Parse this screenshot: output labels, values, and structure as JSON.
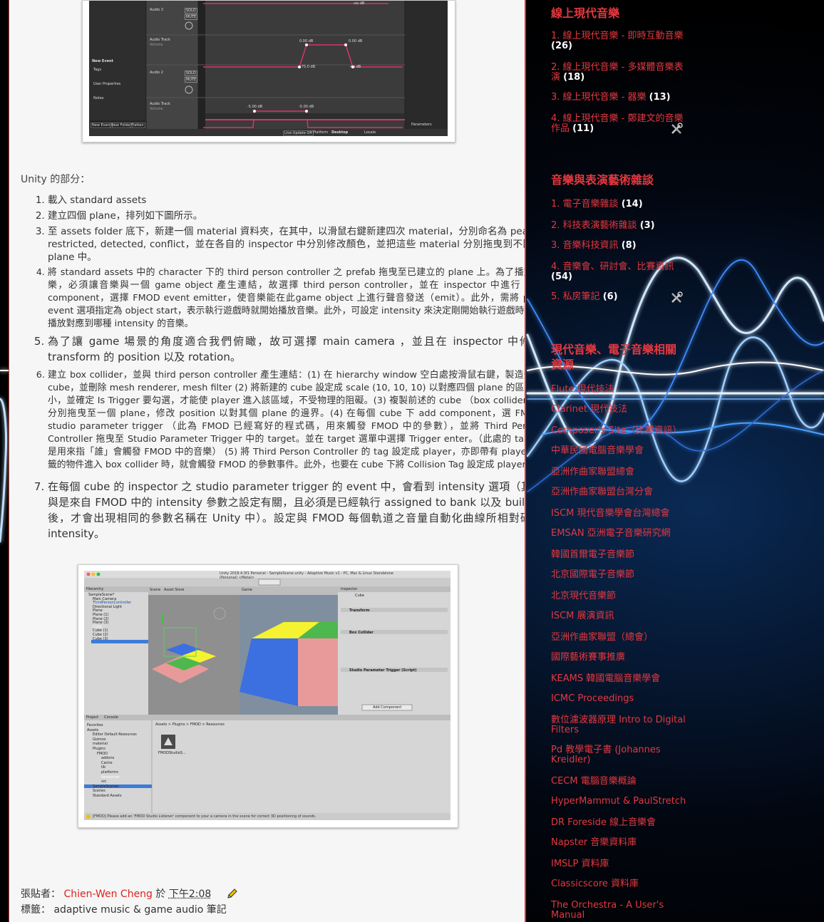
{
  "post": {
    "section_label": "Unity 的部分：",
    "steps": [
      "載入 standard assets",
      "建立四個 plane，排列如下圖所示。",
      "至 assets folder 底下，新建一個 material 資料夾，在其中，以滑鼠右鍵新建四次 material，分別命名為 peace, restricted, detected, conflict，並在各自的 inspector 中分別修改顏色，並把這些 material 分別拖曳到不同的 plane 中。",
      "將 standard assets 中的 character 下的 third person controller 之 prefab 拖曳至已建立的 plane 上。為了播放音樂，必須讓音樂與一個 game object 產生連結，故選擇 third person controller，並在 inspector 中進行 add component，選擇 FMOD event emitter，使音樂能在此game object 上進行聲音發送（emit）。此外，需將 play event 選項指定為 object start，表示執行遊戲時就開始播放音樂。此外，可設定 intensity 來決定剛開始執行遊戲時，需播放對應到哪種 intensity 的音樂。",
      "為了讓 game 場景的角度適合我們俯瞰，故可選擇 main camera ，並且在 inspector 中修改 transform 的 position 以及 rotation。",
      "建立 box collider，並與 third person controller 產生連結：(1) 在 hierarchy window 空白處按滑鼠右鍵，製造一個 cube，並刪除 mesh renderer, mesh filter (2) 將新建的 cube 設定成 scale (10, 10, 10) 以對應四個 plane 的區塊大小，並確定 Is Trigger 要勾選，才能使 player 進入該區域，不受物理的阻礙。(3) 複製前述的 cube （box collider) 並分別拖曳至一個 plane，修改 position 以對其個 plane 的邊界。(4) 在每個 cube 下 add component，選 FMOD studio parameter trigger （此為 FMOD 已經寫好的程式碼，用來觸發 FMOD 中的參數），並將 Third Person Controller 拖曳至 Studio Parameter Trigger 中的 target。並在 target 選單中選擇 Trigger enter。（此處的 target 是用來指「誰」會觸發 FMOD 中的音樂） (5) 將 Third Person Controller 的 tag 設定成 player，亦即帶有 player 標籤的物件進入 box collider 時，就會觸發 FMOD 的參數事件。此外，也要在 cube 下將 Collision Tag 設定成 player。",
      "在每個 cube 的 inspector 之 studio parameter trigger 的 event 中，會看到 intensity 選項（其是與是來自 FMOD 中的 intensity 參數之設定有關，且必須是已經執行 assigned to bank 以及 build之後，才會出現相同的參數名稱在 Unity 中）。設定與 FMOD 每個軌道之音量自動化曲線所相對硬的 intensity。"
    ],
    "footer": {
      "posted_by_label": "張貼者：",
      "author": "Chien-Wen Cheng",
      "at_label": "於",
      "time": "下午2:08",
      "labels_label": "標籤：",
      "labels": "adaptive music & game audio 筆記"
    }
  },
  "fmod_screenshot": {
    "tracks": [
      "Audio 3",
      "Audio Track",
      "Audio 2",
      "Audio Track"
    ],
    "volume_word": "Volume",
    "solo": "SOLO",
    "mute": "MUTE",
    "new_event": "New Event",
    "tags": "Tags",
    "user_properties": "User Properties",
    "notes": "Notes",
    "db_labels": [
      "0.00 dB",
      "0.00 dB",
      "-75.0 dB",
      "-oo dB",
      "-5.00 dB",
      "-5.00 dB",
      "-oo dB"
    ],
    "bottom_buttons": [
      "New Event",
      "New Folder",
      "Flatten"
    ],
    "live_update": "Live Update Off",
    "platform": "Platform",
    "platform_value": "Desktop",
    "locale": "Locale",
    "parameters": "Parameters"
  },
  "unity_screenshot": {
    "title": "Unity 2018.4.3f1 Personal - SampleScene.unity - Adaptive Music v1 - PC, Mac & Linux Standalone (Personal) <Metal>",
    "hierarchy_title": "Hierarchy",
    "hierarchy_items": [
      "SampleScene*",
      "Main Camera",
      "ThirdPersonController",
      "Directional Light",
      "Plane",
      "Plane (1)",
      "Plane (2)",
      "Plane (3)",
      "Cube",
      "Cube (1)",
      "Cube (2)",
      "Cube (3)"
    ],
    "scene_tab": "Scene",
    "asset_store_tab": "Asset Store",
    "game_tab": "Game",
    "inspector_tab": "Inspector",
    "inspector_object": "Cube",
    "components": [
      "Transform",
      "Box Collider",
      "Studio Parameter Trigger (Script)"
    ],
    "add_component": "Add Component",
    "project_tab": "Project",
    "console_tab": "Console",
    "project_tree": [
      "Favorites",
      "Assets",
      "Editor Default Resources",
      "Gizmos",
      "material",
      "Plugins",
      "FMOD",
      "addons",
      "Cache",
      "lib",
      "platforms",
      "Resources",
      "src",
      "SampleScenes",
      "Scenes",
      "Standard Assets"
    ],
    "breadcrumb": "Assets > Plugins > FMOD > Resources",
    "asset_name": "FMODStudioS...",
    "status": "[FMOD] Please add an 'FMOD Studio Listener' component to your a camera in the scene for correct 3D positioning of sounds.",
    "plane_colors": [
      "#f5f230",
      "#4db84d",
      "#3c6fe0",
      "#e89a9a"
    ]
  },
  "sidebar": {
    "widgets": [
      {
        "title": "線上現代音樂",
        "links": [
          {
            "label": "1. 線上現代音樂 - 即時互動音樂",
            "count": "(26)"
          },
          {
            "label": "2. 線上現代音樂 - 多媒體音樂表演",
            "count": "(18)"
          },
          {
            "label": "3. 線上現代音樂 - 器樂",
            "count": "(13)"
          },
          {
            "label": "4. 線上現代音樂 - 鄭建文的音樂作品",
            "count": "(11)"
          }
        ]
      },
      {
        "title": "音樂與表演藝術雜談",
        "links": [
          {
            "label": "1. 電子音樂雜談",
            "count": "(14)"
          },
          {
            "label": "2. 科技表演藝術雜談",
            "count": "(3)"
          },
          {
            "label": "3. 音樂科技資訊",
            "count": "(8)"
          },
          {
            "label": "4. 音樂會、研討會、比賽資訊",
            "count": "(54)"
          },
          {
            "label": "5. 私房筆記",
            "count": "(6)"
          }
        ]
      },
      {
        "title": "現代音樂、電子音樂相關資源",
        "links": [
          {
            "label": "Flute 現代技法"
          },
          {
            "label": "Clarinet 現代技法"
          },
          {
            "label": "Composer's Site（比賽資訊）"
          },
          {
            "label": "中華民國電腦音樂學會"
          },
          {
            "label": "亞洲作曲家聯盟總會"
          },
          {
            "label": "亞洲作曲家聯盟台灣分會"
          },
          {
            "label": "ISCM 現代音樂學會台灣總會"
          },
          {
            "label": "EMSAN 亞洲電子音樂研究網"
          },
          {
            "label": "韓國首爾電子音樂節"
          },
          {
            "label": "北京國際電子音樂節"
          },
          {
            "label": "北京現代音樂節"
          },
          {
            "label": "ISCM 展演資訊"
          },
          {
            "label": "亞洲作曲家聯盟（總會）"
          },
          {
            "label": "國際藝術賽事推廣"
          },
          {
            "label": "KEAMS 韓國電腦音樂學會"
          },
          {
            "label": "ICMC Proceedings"
          },
          {
            "label": "數位濾波器原理 Intro to Digital Filters"
          },
          {
            "label": "Pd 教學電子書 (Johannes Kreidler)"
          },
          {
            "label": "CECM 電腦音樂概論"
          },
          {
            "label": "HyperMammut & PaulStretch"
          },
          {
            "label": "DR Foreside 線上音樂會"
          },
          {
            "label": "Napster 音樂資料庫"
          },
          {
            "label": "IMSLP 資料庫"
          },
          {
            "label": "Classicscore 資料庫"
          },
          {
            "label": "The Orchestra - A User's Manual"
          }
        ]
      }
    ]
  },
  "colors": {
    "accent": "#e4383f",
    "count": "#ffffff",
    "post_bg": "#f6f6f6"
  }
}
